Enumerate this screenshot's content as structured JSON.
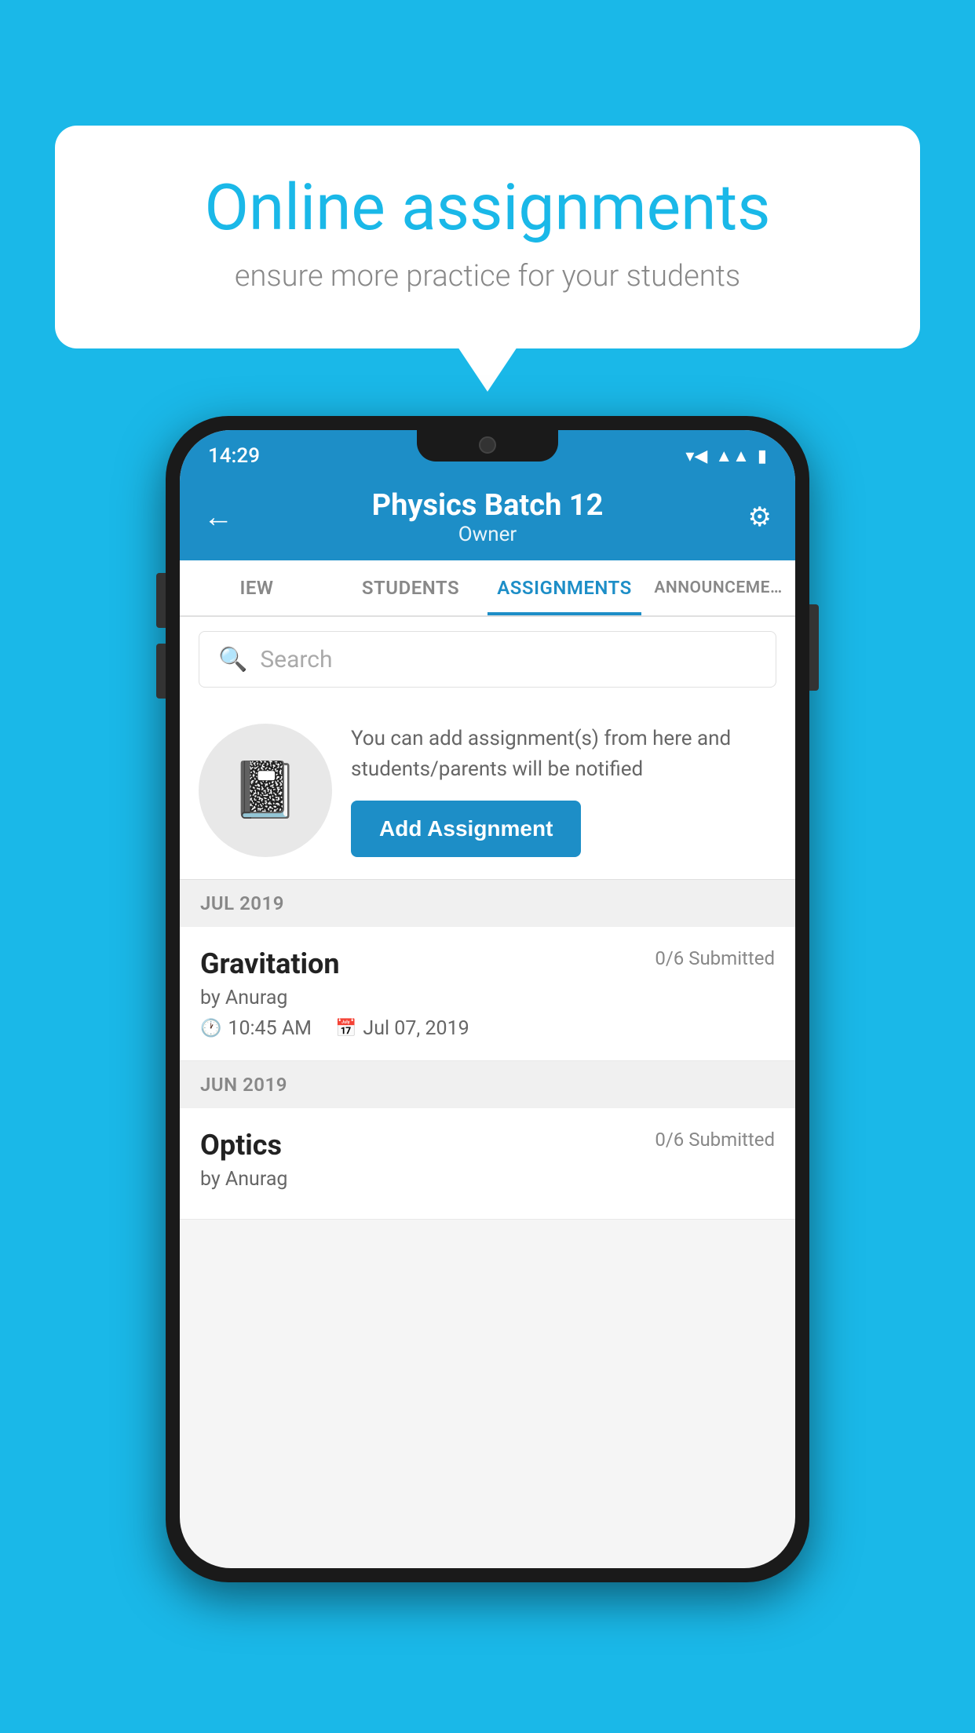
{
  "background_color": "#1ab8e8",
  "speech_bubble": {
    "title": "Online assignments",
    "subtitle": "ensure more practice for your students"
  },
  "status_bar": {
    "time": "14:29",
    "icons": [
      "wifi",
      "signal",
      "battery"
    ]
  },
  "app_bar": {
    "title": "Physics Batch 12",
    "subtitle": "Owner",
    "back_label": "←",
    "settings_label": "⚙"
  },
  "tabs": [
    {
      "label": "IEW",
      "active": false
    },
    {
      "label": "STUDENTS",
      "active": false
    },
    {
      "label": "ASSIGNMENTS",
      "active": true
    },
    {
      "label": "ANNOUNCEME…",
      "active": false
    }
  ],
  "search": {
    "placeholder": "Search"
  },
  "promo": {
    "text": "You can add assignment(s) from here and students/parents will be notified",
    "button_label": "Add Assignment"
  },
  "sections": [
    {
      "header": "JUL 2019",
      "assignments": [
        {
          "title": "Gravitation",
          "submitted": "0/6 Submitted",
          "by": "by Anurag",
          "time": "10:45 AM",
          "date": "Jul 07, 2019"
        }
      ]
    },
    {
      "header": "JUN 2019",
      "assignments": [
        {
          "title": "Optics",
          "submitted": "0/6 Submitted",
          "by": "by Anurag",
          "time": "",
          "date": ""
        }
      ]
    }
  ]
}
